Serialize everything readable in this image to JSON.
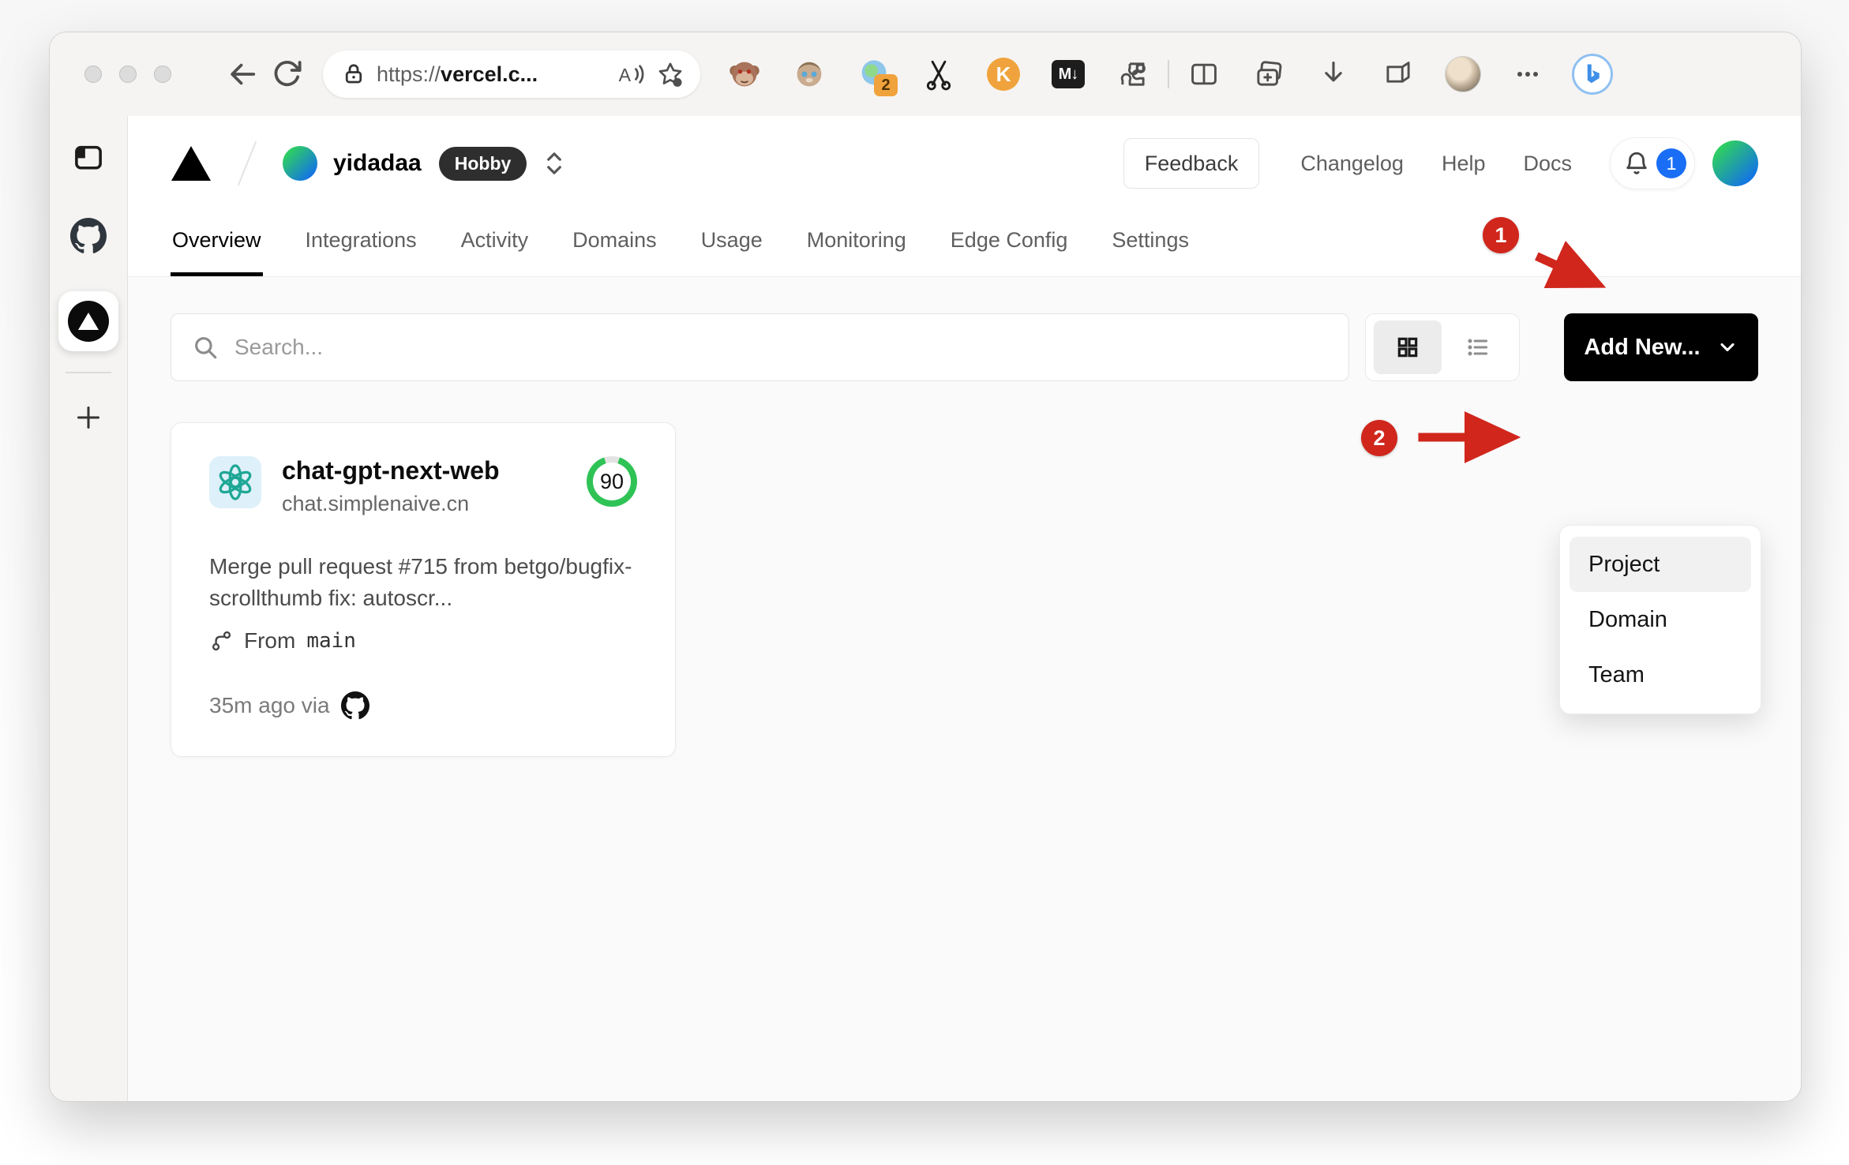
{
  "browser": {
    "url": {
      "scheme": "https://",
      "host": "vercel.c..."
    },
    "extensions": {
      "proxy_badge": "2",
      "kimi_label": "K",
      "markdown_label": "M↓"
    }
  },
  "edge_sidebar": {},
  "header": {
    "team_name": "yidadaa",
    "plan_badge": "Hobby",
    "feedback_label": "Feedback",
    "links": [
      {
        "label": "Changelog"
      },
      {
        "label": "Help"
      },
      {
        "label": "Docs"
      }
    ],
    "notification_count": "1"
  },
  "nav": {
    "tabs": [
      {
        "label": "Overview",
        "active": true
      },
      {
        "label": "Integrations"
      },
      {
        "label": "Activity"
      },
      {
        "label": "Domains"
      },
      {
        "label": "Usage"
      },
      {
        "label": "Monitoring"
      },
      {
        "label": "Edge Config"
      },
      {
        "label": "Settings"
      }
    ]
  },
  "content": {
    "search_placeholder": "Search...",
    "add_new_label": "Add New..."
  },
  "dropdown": {
    "items": [
      {
        "label": "Project",
        "highlighted": true
      },
      {
        "label": "Domain"
      },
      {
        "label": "Team"
      }
    ]
  },
  "project_card": {
    "name": "chat-gpt-next-web",
    "domain": "chat.simplenaive.cn",
    "score": "90",
    "commit_message": "Merge pull request #715 from betgo/bugfix-scrollthumb fix: autoscr...",
    "branch_prefix": "From",
    "branch_name": "main",
    "deployed_info": "35m ago via"
  },
  "annotations": {
    "step1": "1",
    "step2": "2"
  },
  "colors": {
    "accent_red": "#d0261c",
    "score_green": "#2fc356",
    "notification_blue": "#1a6ef5",
    "button_black": "#000000"
  }
}
